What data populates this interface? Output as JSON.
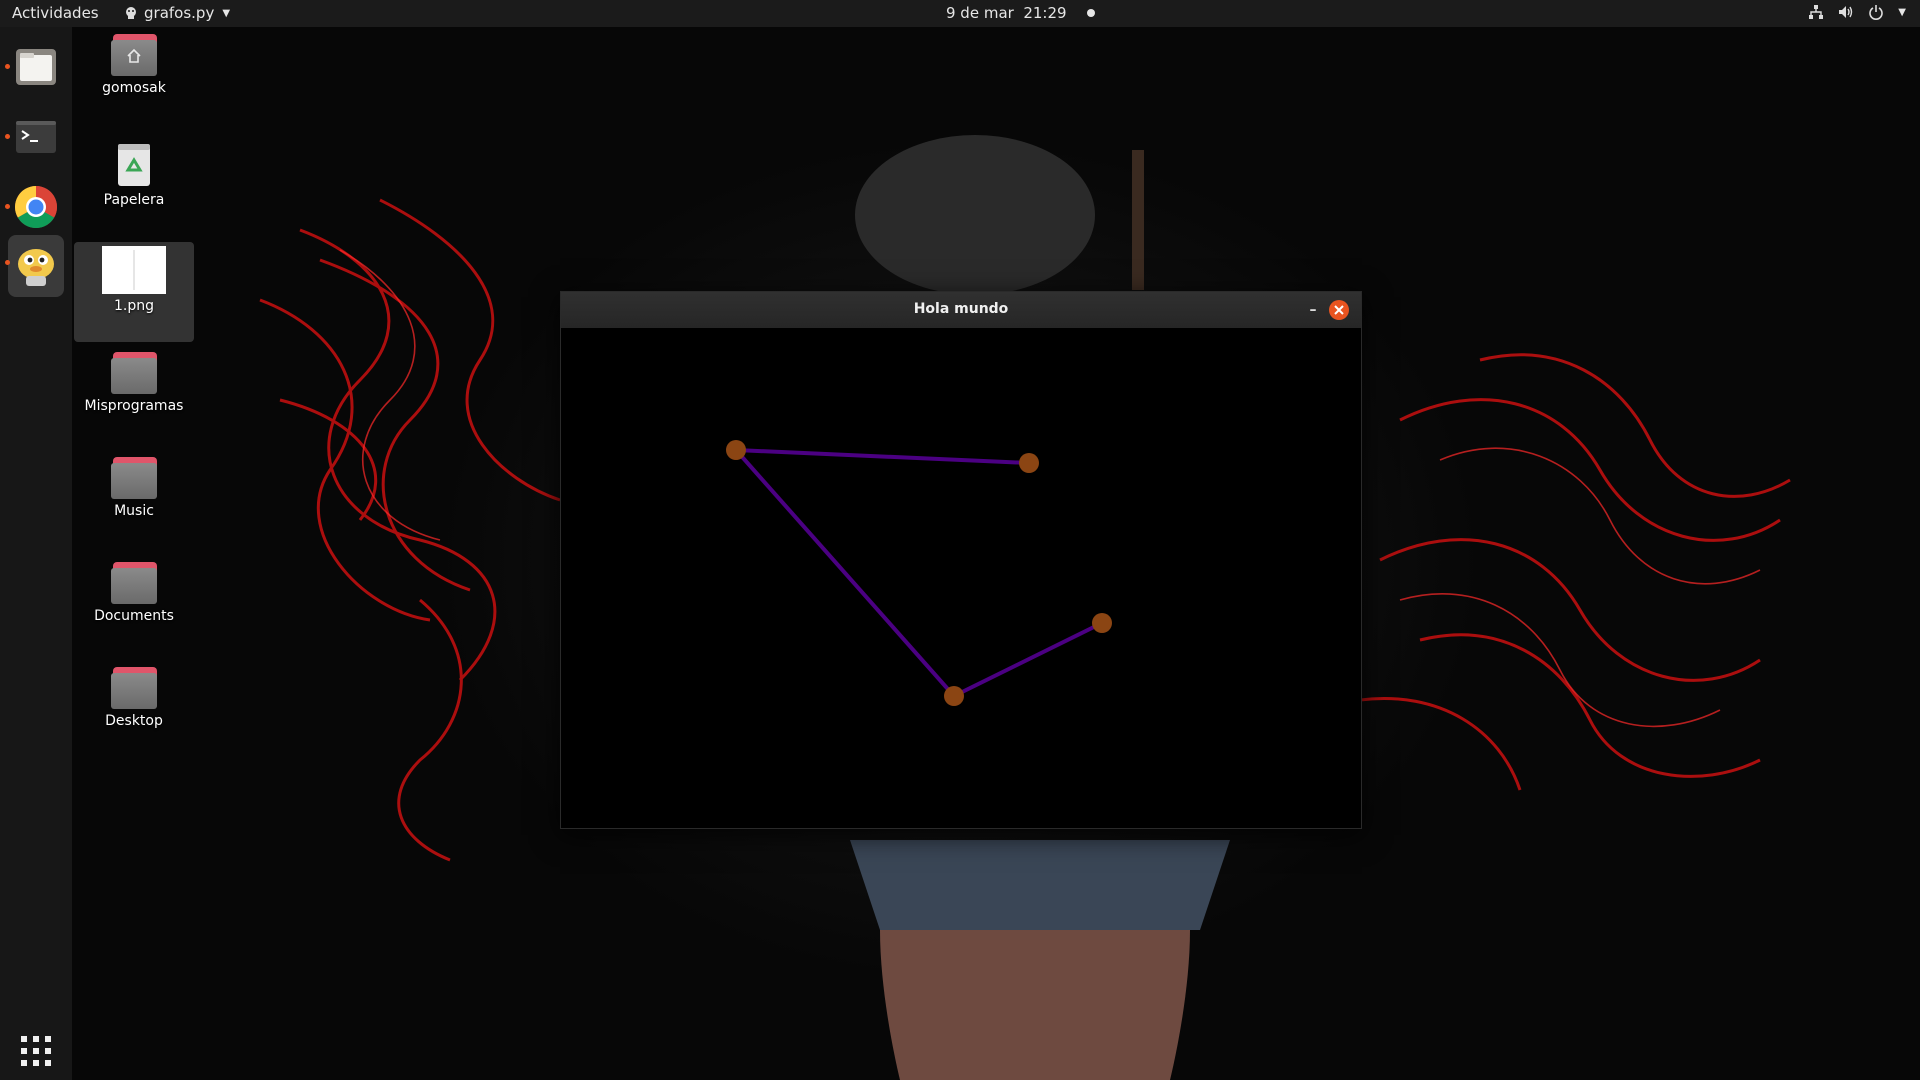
{
  "topbar": {
    "activities": "Actividades",
    "app_name": "grafos.py",
    "datetime": "9 de mar  21:29",
    "tray_icons": [
      "network-icon",
      "volume-icon",
      "power-icon"
    ]
  },
  "dock": {
    "items": [
      {
        "name": "files",
        "icon": "files-icon",
        "running": true
      },
      {
        "name": "terminal",
        "icon": "terminal-icon",
        "running": true
      },
      {
        "name": "chrome",
        "icon": "chrome-icon",
        "running": true
      },
      {
        "name": "python-app",
        "icon": "python-icon",
        "running": true,
        "active": true
      }
    ],
    "show_apps_icon": "grid-icon"
  },
  "desktop": {
    "icons": [
      {
        "label": "gomosak",
        "type": "home-folder"
      },
      {
        "label": "Papelera",
        "type": "trash"
      },
      {
        "label": "1.png",
        "type": "image",
        "selected": true
      },
      {
        "label": "Misprogramas",
        "type": "folder"
      },
      {
        "label": "Music",
        "type": "folder"
      },
      {
        "label": "Documents",
        "type": "folder"
      },
      {
        "label": "Desktop",
        "type": "folder"
      }
    ]
  },
  "window": {
    "title": "Hola mundo",
    "minimize_label": "–",
    "graph": {
      "node_color": "#8b4513",
      "edge_color": "#4b0082",
      "background": "#000000"
    }
  },
  "colors": {
    "accent": "#e95420",
    "topbar_bg": "#1b1b1b",
    "dock_bg": "#171717"
  }
}
